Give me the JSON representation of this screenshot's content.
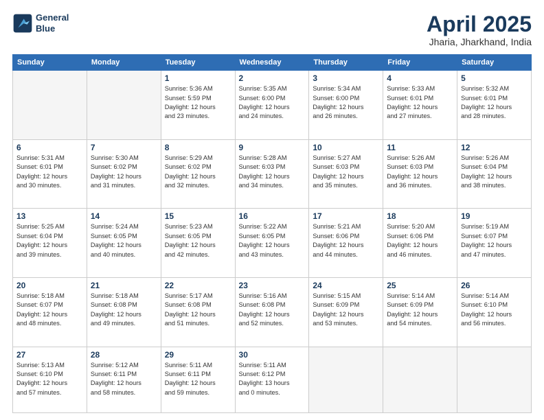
{
  "header": {
    "logo_line1": "General",
    "logo_line2": "Blue",
    "title": "April 2025",
    "subtitle": "Jharia, Jharkhand, India"
  },
  "weekdays": [
    "Sunday",
    "Monday",
    "Tuesday",
    "Wednesday",
    "Thursday",
    "Friday",
    "Saturday"
  ],
  "weeks": [
    [
      {
        "day": "",
        "info": ""
      },
      {
        "day": "",
        "info": ""
      },
      {
        "day": "1",
        "info": "Sunrise: 5:36 AM\nSunset: 5:59 PM\nDaylight: 12 hours\nand 23 minutes."
      },
      {
        "day": "2",
        "info": "Sunrise: 5:35 AM\nSunset: 6:00 PM\nDaylight: 12 hours\nand 24 minutes."
      },
      {
        "day": "3",
        "info": "Sunrise: 5:34 AM\nSunset: 6:00 PM\nDaylight: 12 hours\nand 26 minutes."
      },
      {
        "day": "4",
        "info": "Sunrise: 5:33 AM\nSunset: 6:01 PM\nDaylight: 12 hours\nand 27 minutes."
      },
      {
        "day": "5",
        "info": "Sunrise: 5:32 AM\nSunset: 6:01 PM\nDaylight: 12 hours\nand 28 minutes."
      }
    ],
    [
      {
        "day": "6",
        "info": "Sunrise: 5:31 AM\nSunset: 6:01 PM\nDaylight: 12 hours\nand 30 minutes."
      },
      {
        "day": "7",
        "info": "Sunrise: 5:30 AM\nSunset: 6:02 PM\nDaylight: 12 hours\nand 31 minutes."
      },
      {
        "day": "8",
        "info": "Sunrise: 5:29 AM\nSunset: 6:02 PM\nDaylight: 12 hours\nand 32 minutes."
      },
      {
        "day": "9",
        "info": "Sunrise: 5:28 AM\nSunset: 6:03 PM\nDaylight: 12 hours\nand 34 minutes."
      },
      {
        "day": "10",
        "info": "Sunrise: 5:27 AM\nSunset: 6:03 PM\nDaylight: 12 hours\nand 35 minutes."
      },
      {
        "day": "11",
        "info": "Sunrise: 5:26 AM\nSunset: 6:03 PM\nDaylight: 12 hours\nand 36 minutes."
      },
      {
        "day": "12",
        "info": "Sunrise: 5:26 AM\nSunset: 6:04 PM\nDaylight: 12 hours\nand 38 minutes."
      }
    ],
    [
      {
        "day": "13",
        "info": "Sunrise: 5:25 AM\nSunset: 6:04 PM\nDaylight: 12 hours\nand 39 minutes."
      },
      {
        "day": "14",
        "info": "Sunrise: 5:24 AM\nSunset: 6:05 PM\nDaylight: 12 hours\nand 40 minutes."
      },
      {
        "day": "15",
        "info": "Sunrise: 5:23 AM\nSunset: 6:05 PM\nDaylight: 12 hours\nand 42 minutes."
      },
      {
        "day": "16",
        "info": "Sunrise: 5:22 AM\nSunset: 6:05 PM\nDaylight: 12 hours\nand 43 minutes."
      },
      {
        "day": "17",
        "info": "Sunrise: 5:21 AM\nSunset: 6:06 PM\nDaylight: 12 hours\nand 44 minutes."
      },
      {
        "day": "18",
        "info": "Sunrise: 5:20 AM\nSunset: 6:06 PM\nDaylight: 12 hours\nand 46 minutes."
      },
      {
        "day": "19",
        "info": "Sunrise: 5:19 AM\nSunset: 6:07 PM\nDaylight: 12 hours\nand 47 minutes."
      }
    ],
    [
      {
        "day": "20",
        "info": "Sunrise: 5:18 AM\nSunset: 6:07 PM\nDaylight: 12 hours\nand 48 minutes."
      },
      {
        "day": "21",
        "info": "Sunrise: 5:18 AM\nSunset: 6:08 PM\nDaylight: 12 hours\nand 49 minutes."
      },
      {
        "day": "22",
        "info": "Sunrise: 5:17 AM\nSunset: 6:08 PM\nDaylight: 12 hours\nand 51 minutes."
      },
      {
        "day": "23",
        "info": "Sunrise: 5:16 AM\nSunset: 6:08 PM\nDaylight: 12 hours\nand 52 minutes."
      },
      {
        "day": "24",
        "info": "Sunrise: 5:15 AM\nSunset: 6:09 PM\nDaylight: 12 hours\nand 53 minutes."
      },
      {
        "day": "25",
        "info": "Sunrise: 5:14 AM\nSunset: 6:09 PM\nDaylight: 12 hours\nand 54 minutes."
      },
      {
        "day": "26",
        "info": "Sunrise: 5:14 AM\nSunset: 6:10 PM\nDaylight: 12 hours\nand 56 minutes."
      }
    ],
    [
      {
        "day": "27",
        "info": "Sunrise: 5:13 AM\nSunset: 6:10 PM\nDaylight: 12 hours\nand 57 minutes."
      },
      {
        "day": "28",
        "info": "Sunrise: 5:12 AM\nSunset: 6:11 PM\nDaylight: 12 hours\nand 58 minutes."
      },
      {
        "day": "29",
        "info": "Sunrise: 5:11 AM\nSunset: 6:11 PM\nDaylight: 12 hours\nand 59 minutes."
      },
      {
        "day": "30",
        "info": "Sunrise: 5:11 AM\nSunset: 6:12 PM\nDaylight: 13 hours\nand 0 minutes."
      },
      {
        "day": "",
        "info": ""
      },
      {
        "day": "",
        "info": ""
      },
      {
        "day": "",
        "info": ""
      }
    ]
  ]
}
